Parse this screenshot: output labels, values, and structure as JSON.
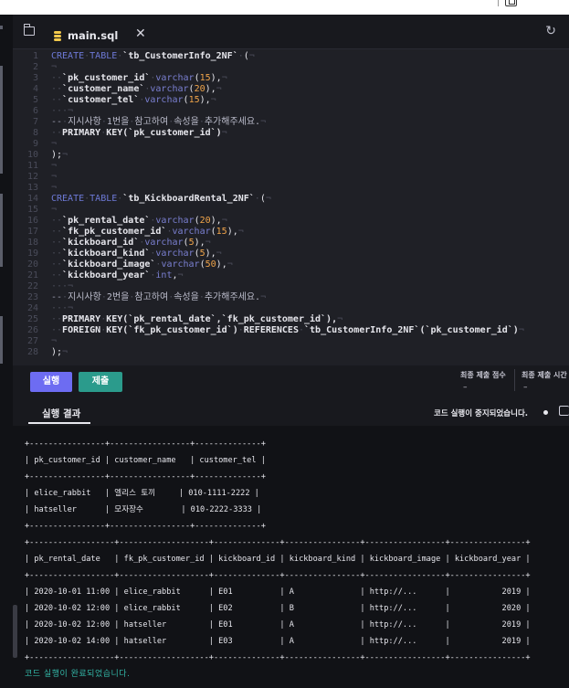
{
  "editor": {
    "tab_label": "main.sql",
    "tab_close": "✕",
    "refresh_icon": "↻",
    "lines": [
      {
        "n": "1",
        "parts": [
          [
            "kw",
            "CREATE"
          ],
          [
            "ws",
            "·"
          ],
          [
            "kw",
            "TABLE"
          ],
          [
            "ws",
            "·"
          ],
          [
            "id",
            "`tb_CustomerInfo_2NF`"
          ],
          [
            "ws",
            "·"
          ],
          [
            "pn",
            "("
          ],
          [
            "ws",
            "¬"
          ]
        ]
      },
      {
        "n": "2",
        "parts": [
          [
            "ws",
            "¬"
          ]
        ]
      },
      {
        "n": "3",
        "parts": [
          [
            "ws",
            "··"
          ],
          [
            "id",
            "`pk_customer_id`"
          ],
          [
            "ws",
            "·"
          ],
          [
            "ty",
            "varchar"
          ],
          [
            "pn",
            "("
          ],
          [
            "nm",
            "15"
          ],
          [
            "pn",
            "),"
          ],
          [
            "ws",
            "¬"
          ]
        ]
      },
      {
        "n": "4",
        "parts": [
          [
            "ws",
            "··"
          ],
          [
            "id",
            "`customer_name`"
          ],
          [
            "ws",
            "·"
          ],
          [
            "ty",
            "varchar"
          ],
          [
            "pn",
            "("
          ],
          [
            "nm",
            "20"
          ],
          [
            "pn",
            "),"
          ],
          [
            "ws",
            "¬"
          ]
        ]
      },
      {
        "n": "5",
        "parts": [
          [
            "ws",
            "··"
          ],
          [
            "id",
            "`customer_tel`"
          ],
          [
            "ws",
            "·"
          ],
          [
            "ty",
            "varchar"
          ],
          [
            "pn",
            "("
          ],
          [
            "nm",
            "15"
          ],
          [
            "pn",
            "),"
          ],
          [
            "ws",
            "¬"
          ]
        ]
      },
      {
        "n": "6",
        "parts": [
          [
            "ws",
            "···¬"
          ]
        ]
      },
      {
        "n": "7",
        "parts": [
          [
            "cm",
            "--"
          ],
          [
            "ws",
            "·"
          ],
          [
            "cmt",
            "지시사항"
          ],
          [
            "ws",
            "·"
          ],
          [
            "cmt",
            "1번을"
          ],
          [
            "ws",
            "·"
          ],
          [
            "cmt",
            "참고하여"
          ],
          [
            "ws",
            "·"
          ],
          [
            "cmt",
            "속성을"
          ],
          [
            "ws",
            "·"
          ],
          [
            "cmt",
            "추가해주세요."
          ],
          [
            "ws",
            "¬"
          ]
        ]
      },
      {
        "n": "8",
        "parts": [
          [
            "ws",
            "··"
          ],
          [
            "id",
            "PRIMARY"
          ],
          [
            "ws",
            "·"
          ],
          [
            "id",
            "KEY(`pk_customer_id`)"
          ],
          [
            "ws",
            "¬"
          ]
        ]
      },
      {
        "n": "9",
        "parts": [
          [
            "ws",
            "¬"
          ]
        ]
      },
      {
        "n": "10",
        "parts": [
          [
            "pn",
            ");"
          ],
          [
            "ws",
            "¬"
          ]
        ]
      },
      {
        "n": "11",
        "parts": [
          [
            "ws",
            "¬"
          ]
        ]
      },
      {
        "n": "12",
        "parts": [
          [
            "ws",
            "¬"
          ]
        ]
      },
      {
        "n": "13",
        "parts": [
          [
            "ws",
            "¬"
          ]
        ]
      },
      {
        "n": "14",
        "parts": [
          [
            "kw",
            "CREATE"
          ],
          [
            "ws",
            "·"
          ],
          [
            "kw",
            "TABLE"
          ],
          [
            "ws",
            "·"
          ],
          [
            "id",
            "`tb_KickboardRental_2NF`"
          ],
          [
            "ws",
            "·"
          ],
          [
            "pn",
            "("
          ],
          [
            "ws",
            "¬"
          ]
        ]
      },
      {
        "n": "15",
        "parts": [
          [
            "ws",
            "¬"
          ]
        ]
      },
      {
        "n": "16",
        "parts": [
          [
            "ws",
            "··"
          ],
          [
            "id",
            "`pk_rental_date`"
          ],
          [
            "ws",
            "·"
          ],
          [
            "ty",
            "varchar"
          ],
          [
            "pn",
            "("
          ],
          [
            "nm",
            "20"
          ],
          [
            "pn",
            "),"
          ],
          [
            "ws",
            "¬"
          ]
        ]
      },
      {
        "n": "17",
        "parts": [
          [
            "ws",
            "··"
          ],
          [
            "id",
            "`fk_pk_customer_id`"
          ],
          [
            "ws",
            "·"
          ],
          [
            "ty",
            "varchar"
          ],
          [
            "pn",
            "("
          ],
          [
            "nm",
            "15"
          ],
          [
            "pn",
            "),"
          ],
          [
            "ws",
            "¬"
          ]
        ]
      },
      {
        "n": "18",
        "parts": [
          [
            "ws",
            "··"
          ],
          [
            "id",
            "`kickboard_id`"
          ],
          [
            "ws",
            "·"
          ],
          [
            "ty",
            "varchar"
          ],
          [
            "pn",
            "("
          ],
          [
            "nm",
            "5"
          ],
          [
            "pn",
            "),"
          ],
          [
            "ws",
            "¬"
          ]
        ]
      },
      {
        "n": "19",
        "parts": [
          [
            "ws",
            "··"
          ],
          [
            "id",
            "`kickboard_kind`"
          ],
          [
            "ws",
            "·"
          ],
          [
            "ty",
            "varchar"
          ],
          [
            "pn",
            "("
          ],
          [
            "nm",
            "5"
          ],
          [
            "pn",
            "),"
          ],
          [
            "ws",
            "¬"
          ]
        ]
      },
      {
        "n": "20",
        "parts": [
          [
            "ws",
            "··"
          ],
          [
            "id",
            "`kickboard_image`"
          ],
          [
            "ws",
            "·"
          ],
          [
            "ty",
            "varchar"
          ],
          [
            "pn",
            "("
          ],
          [
            "nm",
            "50"
          ],
          [
            "pn",
            "),"
          ],
          [
            "ws",
            "¬"
          ]
        ]
      },
      {
        "n": "21",
        "parts": [
          [
            "ws",
            "··"
          ],
          [
            "id",
            "`kickboard_year`"
          ],
          [
            "ws",
            "·"
          ],
          [
            "ty",
            "int"
          ],
          [
            "pn",
            ","
          ],
          [
            "ws",
            "¬"
          ]
        ]
      },
      {
        "n": "22",
        "parts": [
          [
            "ws",
            "···¬"
          ]
        ]
      },
      {
        "n": "23",
        "parts": [
          [
            "cm",
            "--"
          ],
          [
            "ws",
            "·"
          ],
          [
            "cmt",
            "지시사항"
          ],
          [
            "ws",
            "·"
          ],
          [
            "cmt",
            "2번을"
          ],
          [
            "ws",
            "·"
          ],
          [
            "cmt",
            "참고하여"
          ],
          [
            "ws",
            "·"
          ],
          [
            "cmt",
            "속성을"
          ],
          [
            "ws",
            "·"
          ],
          [
            "cmt",
            "추가해주세요."
          ],
          [
            "ws",
            "¬"
          ]
        ]
      },
      {
        "n": "24",
        "parts": [
          [
            "ws",
            "···¬"
          ]
        ]
      },
      {
        "n": "25",
        "parts": [
          [
            "ws",
            "··"
          ],
          [
            "id",
            "PRIMARY"
          ],
          [
            "ws",
            "·"
          ],
          [
            "id",
            "KEY(`pk_rental_date`,`fk_pk_customer_id`),"
          ],
          [
            "ws",
            "¬"
          ]
        ]
      },
      {
        "n": "26",
        "parts": [
          [
            "ws",
            "··"
          ],
          [
            "id",
            "FOREIGN"
          ],
          [
            "ws",
            "·"
          ],
          [
            "id",
            "KEY(`fk_pk_customer_id`)"
          ],
          [
            "ws",
            "·"
          ],
          [
            "id",
            "REFERENCES"
          ],
          [
            "ws",
            "·"
          ],
          [
            "id",
            "`tb_CustomerInfo_2NF`(`pk_customer_id`)"
          ],
          [
            "ws",
            "¬"
          ]
        ]
      },
      {
        "n": "27",
        "parts": [
          [
            "ws",
            "¬"
          ]
        ]
      },
      {
        "n": "28",
        "parts": [
          [
            "pn",
            ");"
          ],
          [
            "ws",
            "¬"
          ]
        ]
      }
    ]
  },
  "actions": {
    "run_label": "실행",
    "submit_label": "제출",
    "score_label": "최종 제출 점수",
    "score_value": "–",
    "time_label": "최종 제출 시간",
    "time_value": "–"
  },
  "results": {
    "tab_label": "실행 결과",
    "status_text": "코드 실행이 중지되었습니다.",
    "done_text": "코드 실행이 완료되었습니다.",
    "output_lines": [
      "+----------------+-----------------+--------------+",
      "| pk_customer_id | customer_name   | customer_tel |",
      "+----------------+-----------------+--------------+",
      "| elice_rabbit   | 엘리스 토끼     | 010-1111-2222 |",
      "| hatseller      | 모자장수        | 010-2222-3333 |",
      "+----------------+-----------------+--------------+",
      "+------------------+-------------------+--------------+----------------+-----------------+----------------+",
      "| pk_rental_date   | fk_pk_customer_id | kickboard_id | kickboard_kind | kickboard_image | kickboard_year |",
      "+------------------+-------------------+--------------+----------------+-----------------+----------------+",
      "| 2020-10-01 11:00 | elice_rabbit      | E01          | A              | http://...      |           2019 |",
      "| 2020-10-02 12:00 | elice_rabbit      | E02          | B              | http://...      |           2020 |",
      "| 2020-10-02 12:00 | hatseller         | E01          | A              | http://...      |           2019 |",
      "| 2020-10-02 14:00 | hatseller         | E03          | A              | http://...      |           2019 |",
      "+------------------+-------------------+--------------+----------------+-----------------+----------------+"
    ]
  }
}
